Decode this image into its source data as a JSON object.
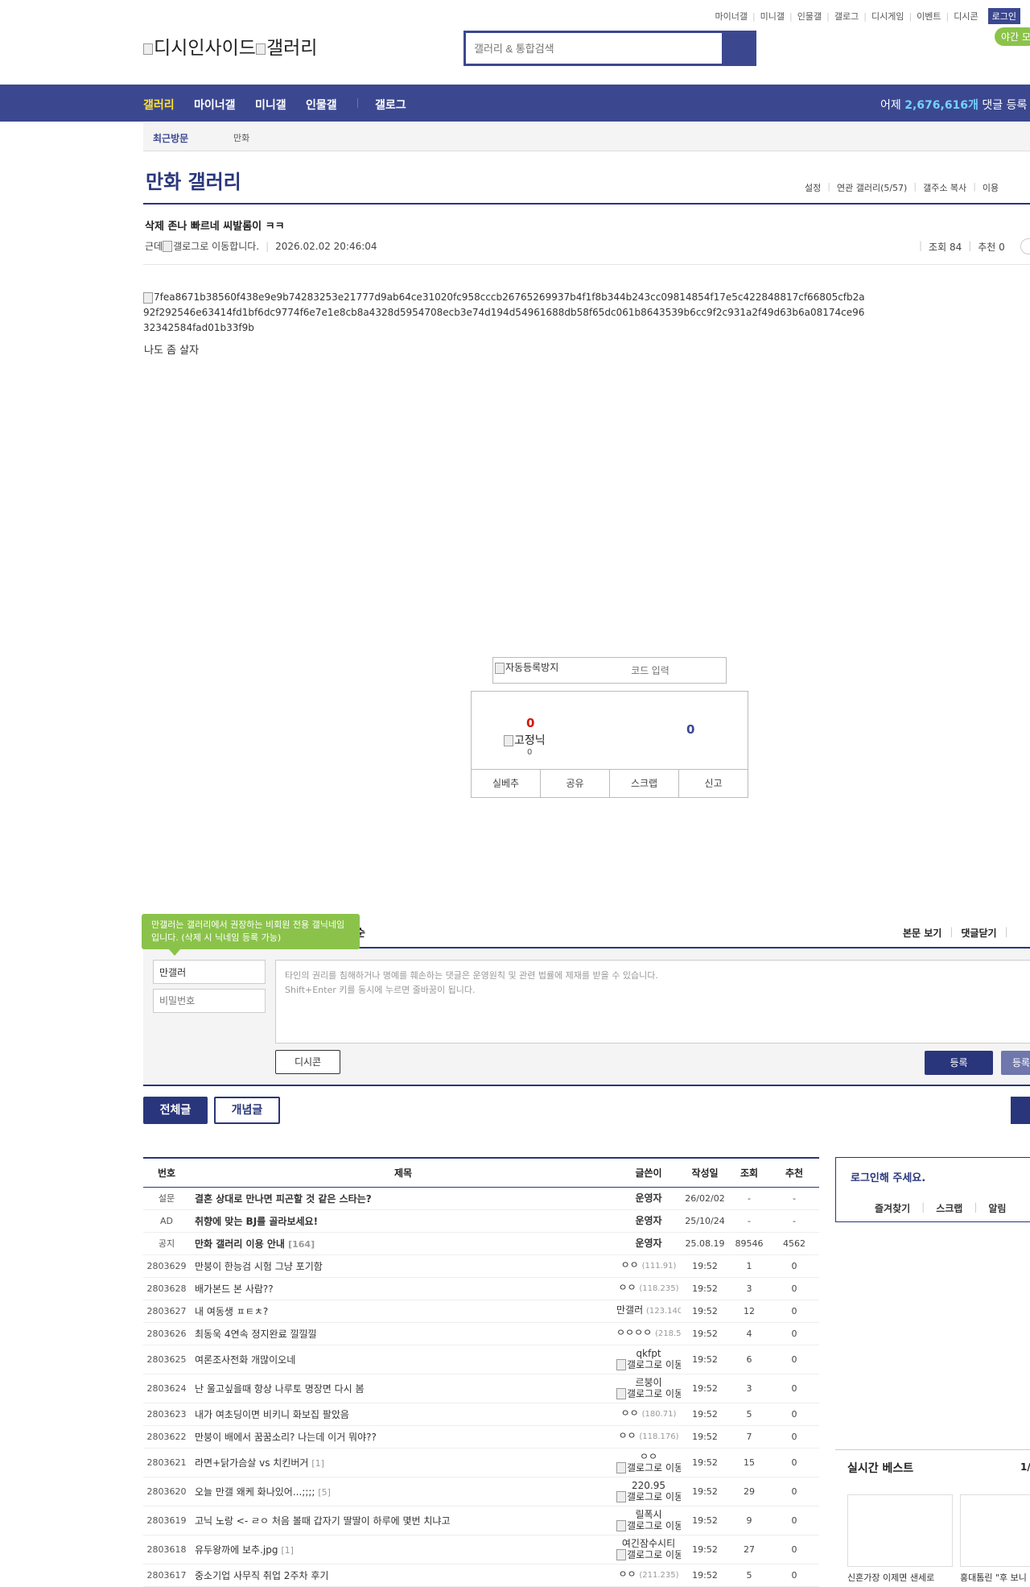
{
  "top_menu": [
    "마이너갤",
    "미니갤",
    "인물갤",
    "갤로그",
    "디시게임",
    "이벤트",
    "디시콘"
  ],
  "login_label": "로그인",
  "night_mode": "야간 모",
  "logo_alt": "디시인사이드",
  "logo_alt2": "갤러리",
  "search_placeholder": "갤러리 & 통합검색",
  "nav": {
    "items": [
      "갤러리",
      "마이너갤",
      "미니갤",
      "인물갤",
      "갤로그"
    ],
    "stat_prefix": "어제 ",
    "stat_value": "2,676,616개",
    "stat_suffix": " 댓글 등록"
  },
  "recent": {
    "label": "최근방문",
    "item": "만화"
  },
  "gallery": {
    "title": "만화 갤러리",
    "menu": [
      "설정",
      "연관 갤러리(5/57)",
      "갤주소 복사",
      "이용"
    ]
  },
  "post": {
    "title": "삭제 존나 빠르네 씨발롬이 ㅋㅋ",
    "author": "근데",
    "author_badge_alt": "갤로그로 이동합니다.",
    "datetime": "2026.02.02 20:46:04",
    "views": "조회 84",
    "recommend": "추천 0",
    "image_alt": "7fea8671b38560f438e9e9b74283253e21777d9ab64ce31020fc958cccb26765269937b4f1f8b344b243cc09814854f17e5c422848817cf66805cfb2a92f292546e63414fd1bf6dc9774f6e7e1e8cb8a4328d5954708ecb3e74d194d54961688db58f65dc061b8643539b6cc9f2c931a2f49d63b6a08174ce9632342584fad01b33f9b",
    "body": "나도 좀 살자"
  },
  "captcha": {
    "img_alt": "자동등록방지",
    "placeholder": "코드 입력"
  },
  "vote": {
    "up": "0",
    "fixed_alt": "고정닉",
    "fixed_count": "0",
    "down": "0",
    "buttons": [
      "실베추",
      "공유",
      "스크랩",
      "신고"
    ]
  },
  "comment": {
    "tooltip": "만갤러는 갤러리에서 권장하는 비회원 전용 갤닉네임입니다. (삭제 시 닉네임 등록 가능)",
    "header_partial": "순",
    "links": [
      "본문 보기",
      "댓글닫기"
    ],
    "nick_value": "만갤러",
    "pw_placeholder": "비밀번호",
    "textarea_line1": "타인의 권리를 침해하거나 명예를 훼손하는 댓글은 운영원칙 및 관련 법률에 제재를 받을 수 있습니다.",
    "textarea_line2": "Shift+Enter 키를 동시에 누르면 줄바꿈이 됩니다.",
    "dccon": "디시콘",
    "register": "등록",
    "register2": "등록"
  },
  "tabs": {
    "all": "전체글",
    "recommended": "개념글"
  },
  "list": {
    "headers": [
      "번호",
      "제목",
      "글쓴이",
      "작성일",
      "조회",
      "추천"
    ],
    "rows": [
      {
        "num": "설문",
        "title": "결혼 상대로 만나면 피곤할 것 같은 스타는?",
        "cc": "",
        "writer": "운영자",
        "ip": "",
        "badge": "",
        "date": "26/02/02",
        "views": "-",
        "rec": "-"
      },
      {
        "num": "AD",
        "title": "취향에 맞는 BJ를 골라보세요!",
        "cc": "",
        "writer": "운영자",
        "ip": "",
        "badge": "",
        "date": "25/10/24",
        "views": "-",
        "rec": "-"
      },
      {
        "num": "공지",
        "title": "만화 갤러리 이용 안내",
        "cc": "[164]",
        "writer": "운영자",
        "ip": "",
        "badge": "",
        "date": "25.08.19",
        "views": "89546",
        "rec": "4562"
      },
      {
        "num": "2803629",
        "title": "만붕이 한능검 시험 그냥 포기함",
        "cc": "",
        "writer": "ㅇㅇ",
        "ip": "(111.91)",
        "badge": "",
        "date": "19:52",
        "views": "1",
        "rec": "0"
      },
      {
        "num": "2803628",
        "title": "배가본드 본 사람??",
        "cc": "",
        "writer": "ㅇㅇ",
        "ip": "(118.235)",
        "badge": "",
        "date": "19:52",
        "views": "3",
        "rec": "0"
      },
      {
        "num": "2803627",
        "title": "내 여동생 ㅍㅌㅊ?",
        "cc": "",
        "writer": "만갤러",
        "ip": "(123.140)",
        "badge": "",
        "date": "19:52",
        "views": "12",
        "rec": "0"
      },
      {
        "num": "2803626",
        "title": "최동욱 4연속 정지완료 낄낄낄",
        "cc": "",
        "writer": "ㅇㅇㅇㅇ",
        "ip": "(218.52)",
        "badge": "",
        "date": "19:52",
        "views": "4",
        "rec": "0"
      },
      {
        "num": "2803625",
        "title": "여론조사전화 개많이오네",
        "cc": "",
        "writer": "qkfpt",
        "ip": "",
        "badge": "갤로그로 이동합니다.",
        "date": "19:52",
        "views": "6",
        "rec": "0"
      },
      {
        "num": "2803624",
        "title": "난 울고싶을때 항상 나루토 명장면 다시 봄",
        "cc": "",
        "writer": "르붕이",
        "ip": "",
        "badge": "갤로그로 이동합니다.",
        "date": "19:52",
        "views": "3",
        "rec": "0"
      },
      {
        "num": "2803623",
        "title": "내가 여초딩이면 비키니 화보집 팔았음",
        "cc": "",
        "writer": "ㅇㅇ",
        "ip": "(180.71)",
        "badge": "",
        "date": "19:52",
        "views": "5",
        "rec": "0"
      },
      {
        "num": "2803622",
        "title": "만붕이 배에서 꿈꿈소리? 나는데 이거 뭐야??",
        "cc": "",
        "writer": "ㅇㅇ",
        "ip": "(118.176)",
        "badge": "",
        "date": "19:52",
        "views": "7",
        "rec": "0"
      },
      {
        "num": "2803621",
        "title": "라면+닭가슴살 vs 치킨버거",
        "cc": "[1]",
        "writer": "ㅇㅇ",
        "ip": "",
        "badge": "갤로그로 이동합니다.",
        "date": "19:52",
        "views": "15",
        "rec": "0"
      },
      {
        "num": "2803620",
        "title": "오늘 만갤 왜케 화나있어...;;;;",
        "cc": "[5]",
        "writer": "220.95",
        "ip": "",
        "badge": "갤로그로 이동합니다.",
        "date": "19:52",
        "views": "29",
        "rec": "0"
      },
      {
        "num": "2803619",
        "title": "고닉 노랑 <- ㄹㅇ 처음 볼때 갑자기 딸딸이 하루에 몇번 치냐고",
        "cc": "",
        "writer": "릴폭시",
        "ip": "",
        "badge": "갤로그로 이동합니다.",
        "date": "19:52",
        "views": "9",
        "rec": "0"
      },
      {
        "num": "2803618",
        "title": "유두왕까에 보추.jpg",
        "cc": "[1]",
        "writer": "여긴잠수시티",
        "ip": "",
        "badge": "갤로그로 이동합니다.",
        "date": "19:52",
        "views": "27",
        "rec": "0"
      },
      {
        "num": "2803617",
        "title": "중소기업 사무직 취업 2주차 후기",
        "cc": "",
        "writer": "ㅇㅇ",
        "ip": "(211.235)",
        "badge": "",
        "date": "19:52",
        "views": "5",
        "rec": "0"
      }
    ]
  },
  "login_box": {
    "title": "로그인해 주세요.",
    "menu": [
      "즐겨찾기",
      "스크랩",
      "알림"
    ]
  },
  "best": {
    "title": "실시간 베스트",
    "page": "1/",
    "captions": [
      "신혼가장 이제면 샌세로",
      "홍대톰린 \"후 보니"
    ]
  }
}
